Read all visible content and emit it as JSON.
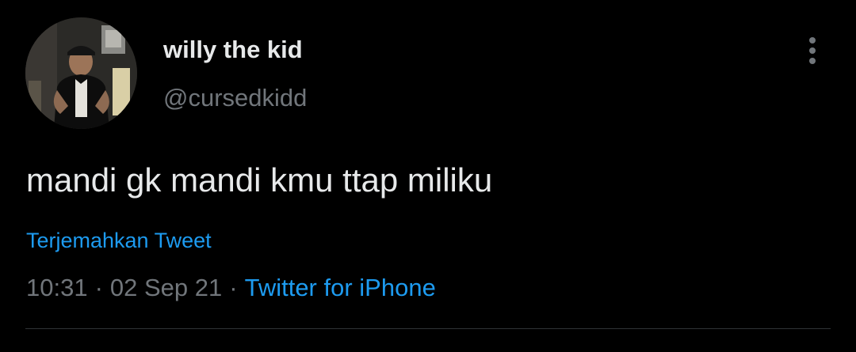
{
  "tweet": {
    "display_name": "willy the kid",
    "handle": "@cursedkidd",
    "text": "mandi gk mandi kmu ttap miliku",
    "translate_label": "Terjemahkan Tweet",
    "time": "10:31",
    "date": "02 Sep 21",
    "separator": "·",
    "source": "Twitter for iPhone",
    "more_icon": "more-vertical-icon"
  },
  "colors": {
    "background": "#000000",
    "primary_text": "#e7e9ea",
    "secondary_text": "#71767b",
    "link": "#1d9bf0",
    "divider": "#2f3336"
  }
}
